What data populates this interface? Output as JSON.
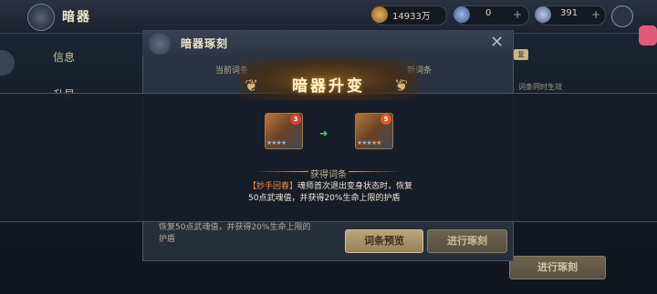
{
  "header": {
    "title": "暗器",
    "currency": [
      {
        "icon": "coin-icon",
        "value": "14933万",
        "color": "#c89b4a"
      },
      {
        "icon": "gem-icon",
        "value": "0",
        "color": "#7a9acb"
      },
      {
        "icon": "crystal-icon",
        "value": "391",
        "color": "#8ea6d0"
      }
    ]
  },
  "sidebar": {
    "items": [
      {
        "label": "信息"
      },
      {
        "label": "升星"
      }
    ]
  },
  "dialog": {
    "title": "暗器琢刻",
    "current_label": "当前词条",
    "new_label": "新词条",
    "bottom_text": "恢复50点武魂值，并获得20%生命上限的护盾",
    "preview_button": "词条预览",
    "run_button": "进行琢刻"
  },
  "background": {
    "run_button": "进行琢刻",
    "tag": "复",
    "note": "词条同时生效"
  },
  "popup": {
    "title": "暗器升变",
    "before_badge": "3",
    "after_badge": "5",
    "section_title": "获得词条",
    "entry_tag": "【妙手回春】",
    "entry_text": "魂师首次退出变身状态时，恢复50点武魂值，并获得20%生命上限的护盾"
  }
}
